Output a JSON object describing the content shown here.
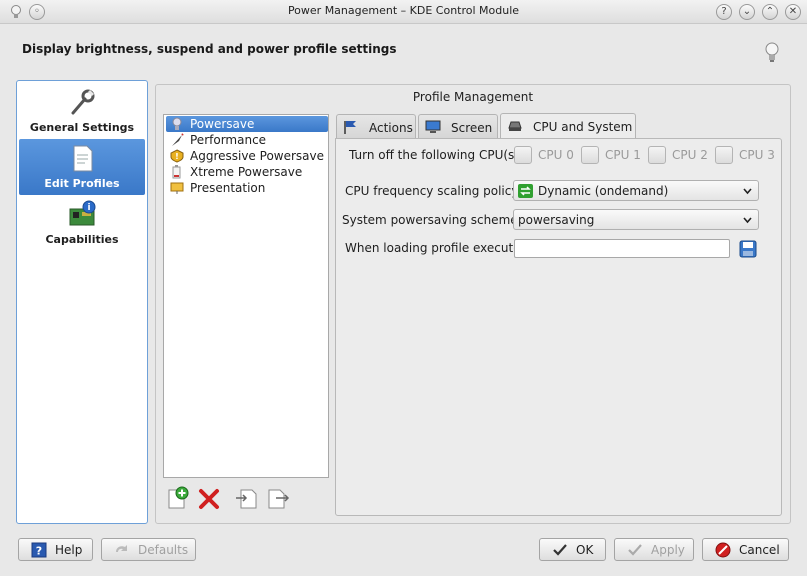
{
  "window": {
    "title": "Power Management – KDE Control Module",
    "help_glyph": "?",
    "menu_glyph": "◦",
    "minimize_glyph": "⌄",
    "maximize_glyph": "⌃",
    "close_glyph": "✕"
  },
  "header": {
    "description": "Display brightness, suspend and power profile settings"
  },
  "sidebar": {
    "items": [
      {
        "label": "General Settings",
        "icon": "wrench-icon"
      },
      {
        "label": "Edit Profiles",
        "icon": "document-icon",
        "selected": true
      },
      {
        "label": "Capabilities",
        "icon": "hardware-icon"
      }
    ]
  },
  "profile_management": {
    "title": "Profile Management",
    "profiles": [
      {
        "label": "Powersave",
        "icon": "powersave-icon",
        "selected": true
      },
      {
        "label": "Performance",
        "icon": "performance-icon"
      },
      {
        "label": "Aggressive Powersave",
        "icon": "aggressive-icon"
      },
      {
        "label": "Xtreme Powersave",
        "icon": "xtreme-icon"
      },
      {
        "label": "Presentation",
        "icon": "presentation-icon"
      }
    ]
  },
  "tabs": [
    {
      "label": "Actions",
      "icon": "flag-icon"
    },
    {
      "label": "Screen",
      "icon": "monitor-icon"
    },
    {
      "label": "CPU and System",
      "icon": "chip-icon",
      "active": true
    }
  ],
  "cpu_system": {
    "turn_off_label": "Turn off the following CPU(s)",
    "cpus": [
      "CPU 0",
      "CPU 1",
      "CPU 2",
      "CPU 3"
    ],
    "freq_label": "CPU frequency scaling policy:",
    "freq_value": "Dynamic (ondemand)",
    "scheme_label": "System powersaving scheme:",
    "scheme_value": "powersaving",
    "execute_label": "When loading profile execute:",
    "execute_value": ""
  },
  "buttons": {
    "help": "Help",
    "defaults": "Defaults",
    "ok": "OK",
    "apply": "Apply",
    "cancel": "Cancel"
  },
  "colors": {
    "selection": "#3a78c8",
    "sidebar_border": "#6ea0d8"
  }
}
